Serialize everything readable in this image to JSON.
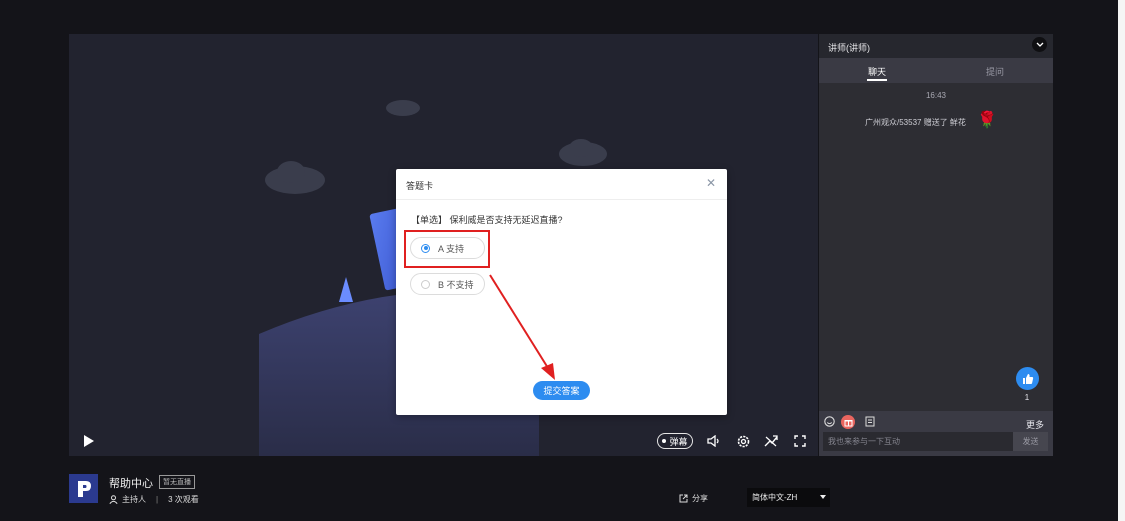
{
  "modal": {
    "title": "答题卡",
    "close_icon": "✕",
    "question": "【单选】 保利威是否支持无延迟直播?",
    "options": [
      {
        "label": "A  支持",
        "selected": true
      },
      {
        "label": "B  不支持",
        "selected": false
      }
    ],
    "submit_label": "提交答案"
  },
  "player": {
    "danmu_label": "弹幕",
    "icons": [
      "play-icon",
      "volume-icon",
      "settings-icon",
      "line-switch-icon",
      "fullscreen-icon"
    ]
  },
  "sidebar": {
    "header_title": "讲师(讲师)",
    "tabs": [
      {
        "label": "聊天",
        "active": true
      },
      {
        "label": "提问",
        "active": false
      }
    ],
    "chat": {
      "time": "16:43",
      "message": "广州观众/53537 赠送了 鲜花",
      "gift_icon": "rose-icon"
    },
    "like_count": "1",
    "more_label": "更多",
    "input_placeholder": "我也来参与一下互动",
    "send_label": "发送"
  },
  "footer": {
    "title": "帮助中心",
    "status_badge": "暂无直播",
    "host_label": "主持人",
    "separator": "|",
    "views": "3 次观看",
    "share_label": "分享",
    "language": "简体中文-ZH"
  },
  "colors": {
    "accent": "#2d8cf0",
    "highlight": "#e02020",
    "player_bg": "#22232f",
    "sidebar_bg": "#2d2d33"
  }
}
